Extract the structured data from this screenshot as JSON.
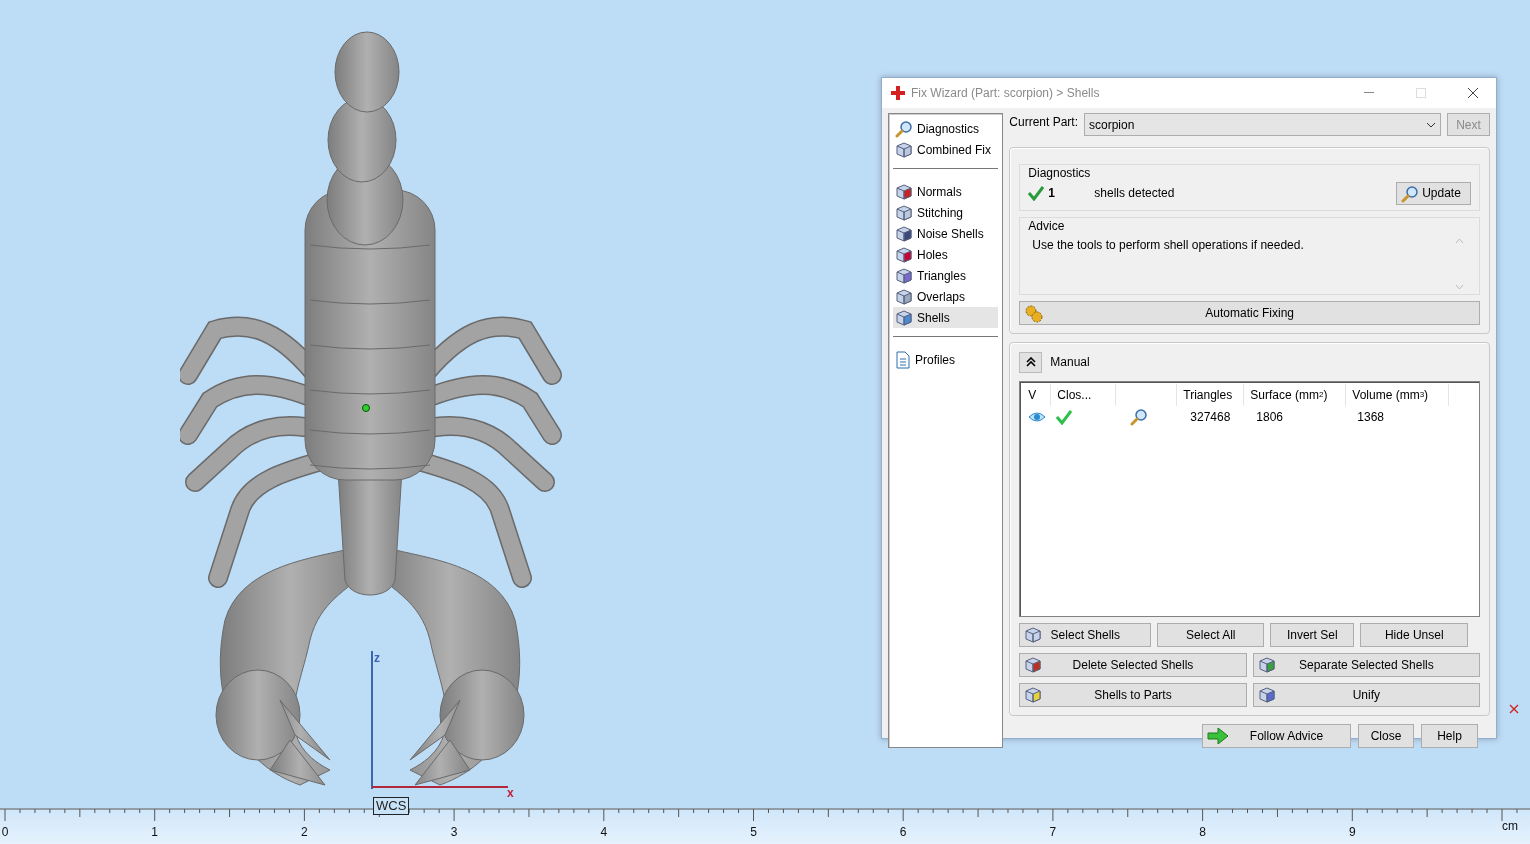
{
  "viewport": {
    "axes": {
      "z": "z",
      "x": "x"
    },
    "wcs_label": "WCS"
  },
  "ruler": {
    "ticks": [
      "0",
      "1",
      "2",
      "3",
      "4",
      "5",
      "6",
      "7",
      "8",
      "9"
    ],
    "unit": "cm"
  },
  "dialog": {
    "title": "Fix Wizard (Part: scorpion) > Shells",
    "active": false,
    "sidebar": [
      [
        {
          "label": "Diagnostics",
          "selected": false
        },
        {
          "label": "Combined Fix",
          "selected": false
        }
      ],
      [
        {
          "label": "Normals",
          "selected": false
        },
        {
          "label": "Stitching",
          "selected": false
        },
        {
          "label": "Noise Shells",
          "selected": false
        },
        {
          "label": "Holes",
          "selected": false
        },
        {
          "label": "Triangles",
          "selected": false
        },
        {
          "label": "Overlaps",
          "selected": false
        },
        {
          "label": "Shells",
          "selected": true
        }
      ],
      [
        {
          "label": "Profiles",
          "selected": false
        }
      ]
    ],
    "current_part": {
      "label": "Current Part:",
      "value": "scorpion"
    },
    "next_button": {
      "label": "Next",
      "disabled": true
    },
    "diagnostics": {
      "title": "Diagnostics",
      "ok": true,
      "count": "1",
      "text": "shells detected",
      "update": "Update"
    },
    "advice": {
      "title": "Advice",
      "text": "Use the tools to perform shell operations if needed."
    },
    "automatic_fixing": "Automatic Fixing",
    "manual": {
      "title": "Manual",
      "expanded": true,
      "columns": [
        {
          "label": "V"
        },
        {
          "label": "Clos..."
        },
        {},
        {
          "label": "Triangles"
        },
        {
          "label": "Surface (mm$^{2}$)"
        },
        {
          "label": "Volume (mm$^{3}$)"
        }
      ],
      "rows": [
        {
          "visible": true,
          "closed": true,
          "triangles": "327468",
          "surface": "1806",
          "volume": "1368"
        }
      ],
      "buttons": [
        [
          "Select Shells",
          "Select All",
          "Invert Sel",
          "Hide Unsel"
        ],
        [
          "Delete Selected Shells",
          "Separate Selected Shells"
        ],
        [
          "Shells to Parts",
          "Unify"
        ]
      ]
    },
    "footer": [
      "Follow Advice",
      "Close",
      "Help"
    ]
  }
}
